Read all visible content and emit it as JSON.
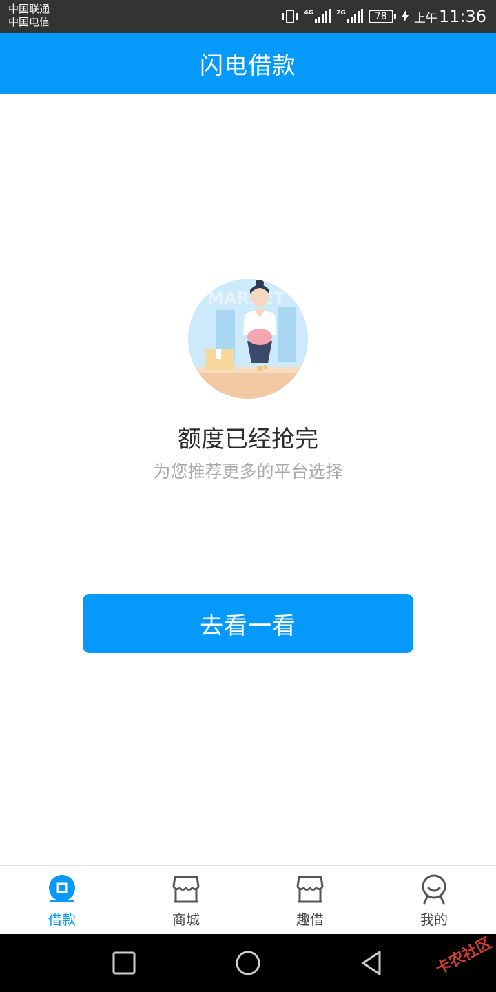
{
  "status_bar": {
    "carrier_1": "中国联通",
    "carrier_2": "中国电信",
    "network_1": "4G",
    "network_2": "2G",
    "battery": "78",
    "ampm": "上午",
    "time": "11:36",
    "icons": [
      "vibrate-icon",
      "signal-icon",
      "battery-icon",
      "charging-icon"
    ]
  },
  "header": {
    "title": "闪电借款"
  },
  "main": {
    "illustration_text": "MARKET",
    "title": "额度已经抢完",
    "subtitle": "为您推荐更多的平台选择",
    "button_label": "去看一看"
  },
  "tabs": [
    {
      "label": "借款",
      "icon": "loan-icon",
      "active": true
    },
    {
      "label": "商城",
      "icon": "store-icon",
      "active": false
    },
    {
      "label": "趣借",
      "icon": "store-icon",
      "active": false
    },
    {
      "label": "我的",
      "icon": "profile-icon",
      "active": false
    }
  ],
  "nav_bar": {
    "buttons": [
      "recents-square-icon",
      "home-circle-icon",
      "back-triangle-icon"
    ],
    "watermark": "卡农社区"
  },
  "colors": {
    "brand_blue": "#0499fb",
    "status_bar": "#333333",
    "title_text": "#2b2b2b",
    "subtitle_text": "#a8a8a8",
    "tab_inactive": "#444444"
  }
}
